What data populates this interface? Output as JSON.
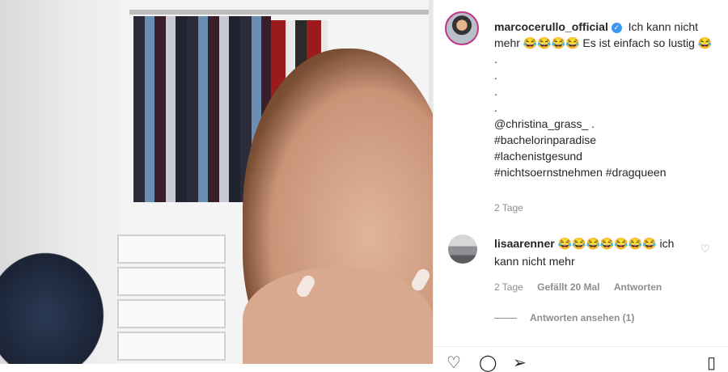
{
  "post": {
    "username": "marcocerullo_official",
    "verified_badge": "verified-icon",
    "caption_lines": [
      "Ich kann nicht mehr 😂😂😂😂 Es ist einfach so lustig 😂 .",
      ".",
      ".",
      ".",
      "@christina_grass_ .",
      "#bachelorinparadise",
      "#lachenistgesund",
      "#nichtsoernstnehmen #dragqueen"
    ],
    "time": "2 Tage"
  },
  "comment": {
    "username": "lisaarenner",
    "text": "😂😂😂😂😂😂😂 ich kann nicht mehr",
    "time": "2 Tage",
    "likes": "Gefällt 20 Mal",
    "reply_label": "Antworten",
    "view_replies_label": "Antworten ansehen (1)"
  },
  "actions": {
    "like_icon": "heart-icon",
    "comment_icon": "comment-icon",
    "share_icon": "share-icon",
    "save_icon": "bookmark-icon"
  }
}
